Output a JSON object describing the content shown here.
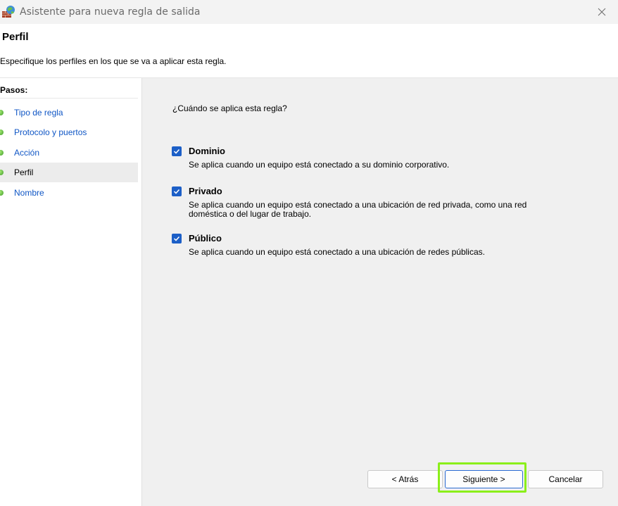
{
  "window": {
    "title": "Asistente para nueva regla de salida",
    "app_icon": "firewall-globe-icon",
    "close_icon": "close-icon"
  },
  "header": {
    "title": "Perfil",
    "subtitle": "Especifique los perfiles en los que se va a aplicar esta regla."
  },
  "sidebar": {
    "title": "Pasos:",
    "items": [
      {
        "label": "Tipo de regla",
        "current": false
      },
      {
        "label": "Protocolo y puertos",
        "current": false
      },
      {
        "label": "Acción",
        "current": false
      },
      {
        "label": "Perfil",
        "current": true
      },
      {
        "label": "Nombre",
        "current": false
      }
    ]
  },
  "main": {
    "question": "¿Cuándo se aplica esta regla?",
    "options": [
      {
        "label": "Dominio",
        "checked": true,
        "description": "Se aplica cuando un equipo está conectado a su dominio corporativo."
      },
      {
        "label": "Privado",
        "checked": true,
        "description": "Se aplica cuando un equipo está conectado a una ubicación de red privada, como una red doméstica o del lugar de trabajo."
      },
      {
        "label": "Público",
        "checked": true,
        "description": "Se aplica cuando un equipo está conectado a una ubicación de redes públicas."
      }
    ]
  },
  "buttons": {
    "back": "< Atrás",
    "next": "Siguiente >",
    "cancel": "Cancelar"
  },
  "colors": {
    "accent": "#1c5fc7",
    "link": "#0f56c5",
    "highlight": "#8bef1a"
  }
}
